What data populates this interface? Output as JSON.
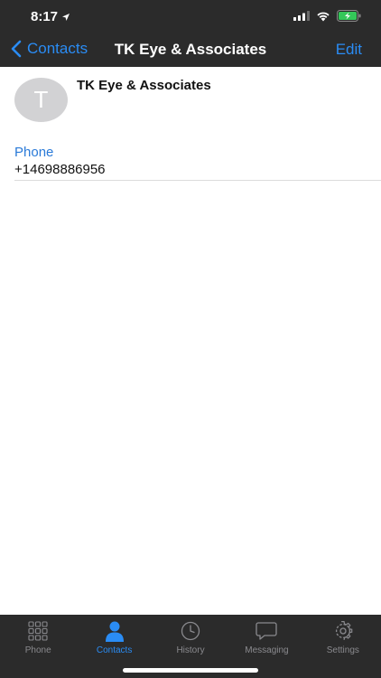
{
  "status_bar": {
    "time": "8:17",
    "location_icon": "location-arrow-icon",
    "signal_icon": "cellular-signal-icon",
    "wifi_icon": "wifi-icon",
    "battery_icon": "battery-charging-icon",
    "battery_color": "#34c759"
  },
  "nav": {
    "back_label": "Contacts",
    "title": "TK Eye & Associates",
    "edit_label": "Edit"
  },
  "contact": {
    "avatar_initial": "T",
    "name": "TK Eye & Associates",
    "phone_label": "Phone",
    "phone_value": "+14698886956"
  },
  "tabs": [
    {
      "label": "Phone",
      "icon": "keypad-icon",
      "active": false
    },
    {
      "label": "Contacts",
      "icon": "person-icon",
      "active": true
    },
    {
      "label": "History",
      "icon": "clock-icon",
      "active": false
    },
    {
      "label": "Messaging",
      "icon": "chat-bubble-icon",
      "active": false
    },
    {
      "label": "Settings",
      "icon": "gear-icon",
      "active": false
    }
  ],
  "colors": {
    "accent": "#2a8cf4",
    "header_bg": "#2b2b2b",
    "field_label": "#2a7ad8",
    "inactive_tab": "#8a8a8e"
  }
}
